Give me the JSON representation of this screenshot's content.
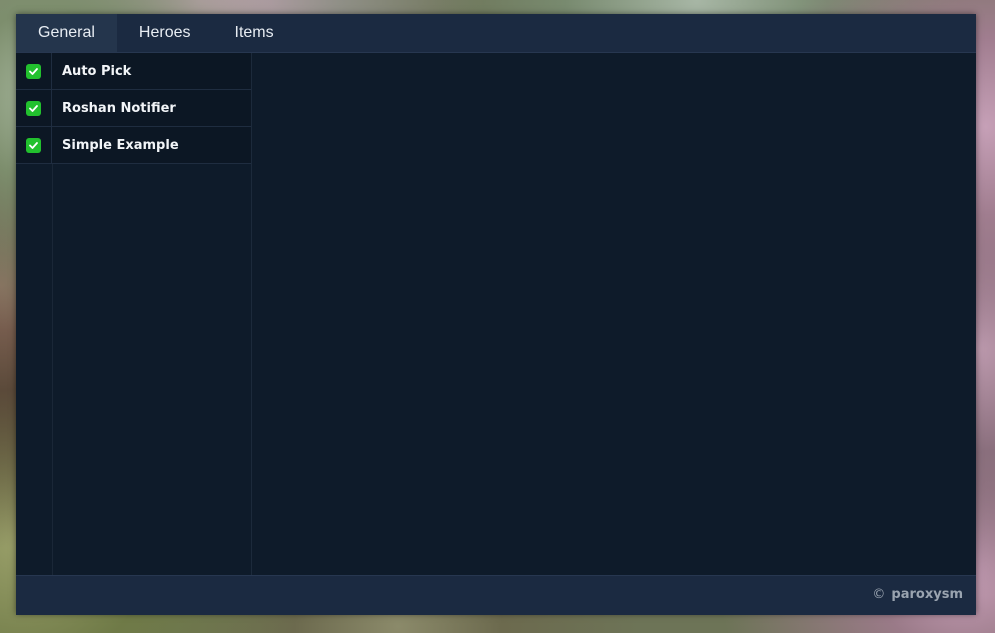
{
  "tabs": [
    {
      "label": "General",
      "active": true
    },
    {
      "label": "Heroes",
      "active": false
    },
    {
      "label": "Items",
      "active": false
    }
  ],
  "sidebar": {
    "items": [
      {
        "label": "Auto Pick",
        "checked": true
      },
      {
        "label": "Roshan Notifier",
        "checked": true
      },
      {
        "label": "Simple Example",
        "checked": true
      }
    ]
  },
  "footer": {
    "copyright_symbol": "©",
    "author": "paroxysm"
  },
  "colors": {
    "panel_bg": "#0e1b2a",
    "header_bg": "#1b2a41",
    "checkbox_on": "#22c12e"
  }
}
